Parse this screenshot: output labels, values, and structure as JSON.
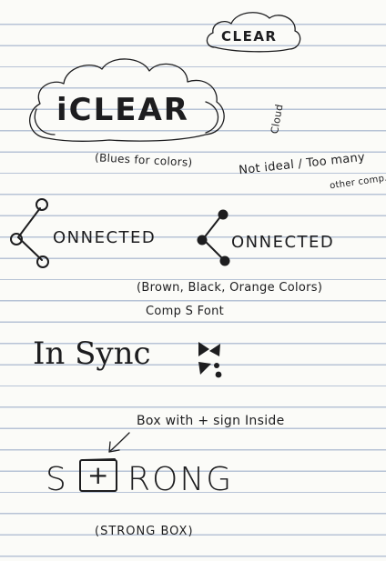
{
  "notes": {
    "clear_small": "CLEAR",
    "iclear_big": "iCLEAR",
    "blues_note": "(Blues for colors)",
    "cloud_note_top": "Cloud",
    "cloud_note_main": "Not ideal / Too many",
    "cloud_note_tail": "other comp.",
    "connected_outline": "ONNECTED",
    "connected_filled": "ONNECTED",
    "brown_note": "(Brown, Black, Orange Colors)",
    "comp_font": "Comp S Font",
    "in_sync": "In Sync",
    "box_note": "Box with + sign Inside",
    "strong_s": "S",
    "strong_plus": "+",
    "strong_rest": "RONG",
    "strong_box_note": "(STRONG BOX)"
  }
}
